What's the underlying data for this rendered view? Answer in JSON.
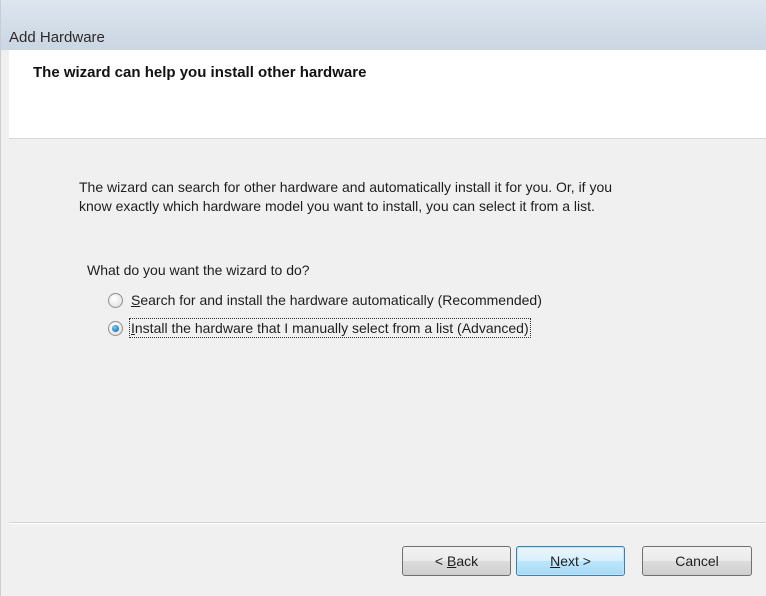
{
  "window": {
    "title": "Add Hardware"
  },
  "header": {
    "heading": "The wizard can help you install other hardware"
  },
  "content": {
    "intro_line1": "The wizard can search for other hardware and automatically install it for you. Or, if you",
    "intro_line2": "know exactly which hardware model you want to install, you can select it from a list.",
    "question": "What do you want the wizard to do?",
    "options": [
      {
        "accel": "S",
        "rest": "earch for and install the hardware automatically (Recommended)",
        "checked": false
      },
      {
        "accel": "I",
        "rest": "nstall the hardware that I manually select from a list (Advanced)",
        "checked": true
      }
    ]
  },
  "buttons": {
    "back_prefix": "< ",
    "back_accel": "B",
    "back_rest": "ack",
    "next_accel": "N",
    "next_rest": "ext >",
    "cancel": "Cancel"
  },
  "colors": {
    "titlebar": "#d3dde8",
    "header_bg": "#ffffff",
    "body_bg": "#f0f0f0",
    "radio_checked": "#2a86c9"
  }
}
